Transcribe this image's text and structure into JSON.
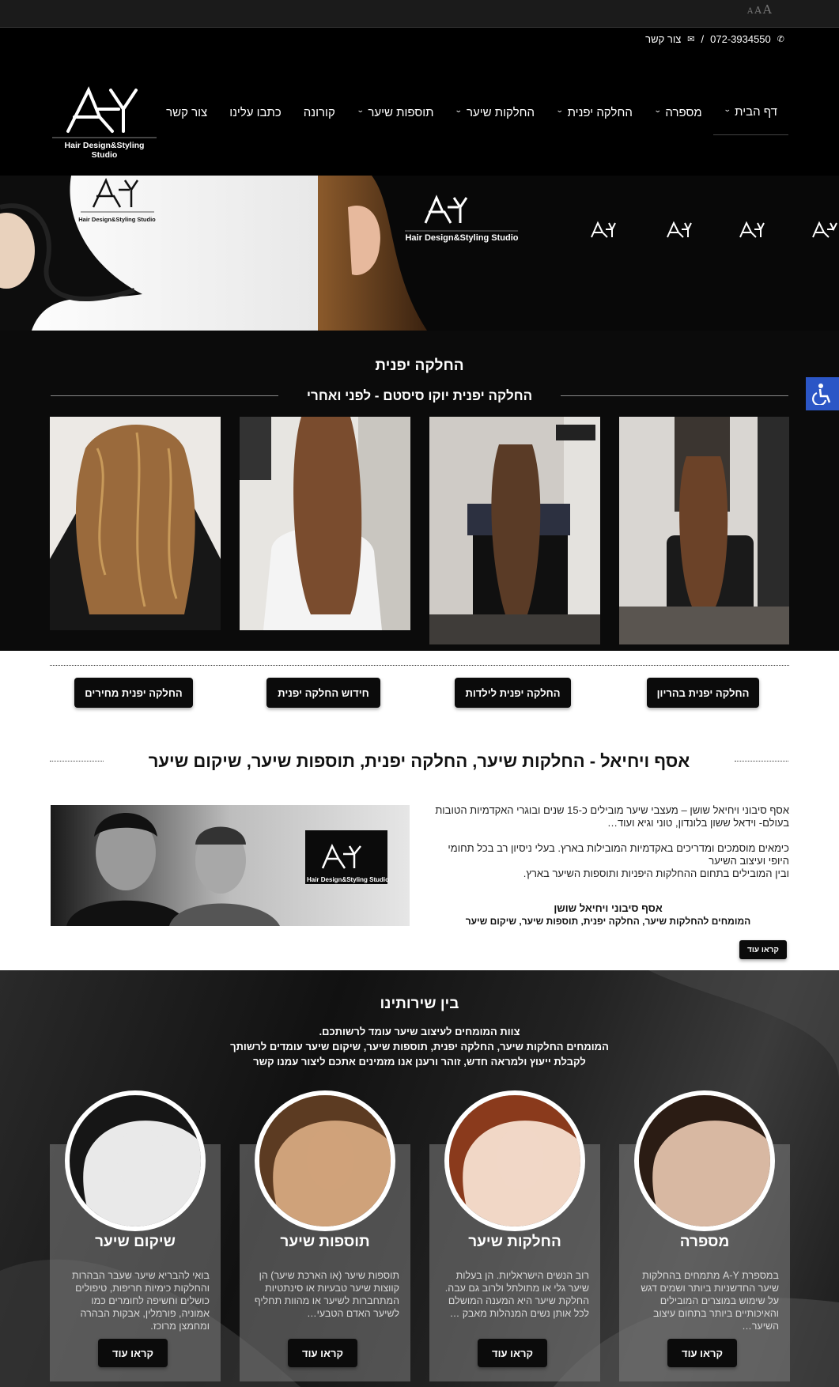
{
  "font_sizer": {
    "small": "A",
    "medium": "A",
    "large": "A"
  },
  "header": {
    "phone": "072-3934550",
    "separator": "/",
    "contact_link": "צור קשר",
    "logo_text": "Hair Design&Styling Studio",
    "logo_mark": "AY"
  },
  "nav": [
    {
      "label": "דף הבית",
      "dropdown": true,
      "active": true
    },
    {
      "label": "מספרה",
      "dropdown": true
    },
    {
      "label": "החלקה יפנית",
      "dropdown": true
    },
    {
      "label": "החלקות שיער",
      "dropdown": true
    },
    {
      "label": "תוספות שיער",
      "dropdown": true
    },
    {
      "label": "קורונה",
      "dropdown": false
    },
    {
      "label": "כתבו עלינו",
      "dropdown": false
    },
    {
      "label": "צור קשר",
      "dropdown": false
    }
  ],
  "banner": {
    "logo_text": "Hair Design&Styling Studio"
  },
  "gallery": {
    "title": "החלקה יפנית",
    "subtitle": "החלקה יפנית יוקו סיסטם - לפני ואחרי"
  },
  "japanese_buttons": [
    "החלקה יפנית בהריון",
    "החלקה יפנית לילדות",
    "חידוש החלקה יפנית",
    "החלקה יפנית מחירים"
  ],
  "about": {
    "heading": "אסף ויחיאל - החלקות שיער, החלקה יפנית, תוספות שיער, שיקום שיער",
    "p1": "אסף סיבוני ויחיאל שושן – מעצבי שיער מובילים כ-15 שנים ובוגרי האקדמיות הטובות בעולם- וידאל ששון בלונדון, טוני וגיא ועוד…",
    "p2": "כימאים מוסמכים ומדריכים באקדמיות המובילות בארץ. בעלי ניסיון רב בכל תחומי היופי ועיצוב השיער",
    "p3": "ובין המובילים בתחום ההחלקות היפניות ותוספות השיער בארץ.",
    "names": "אסף סיבוני ויחיאל שושן",
    "tagline": "המומחים להחלקות שיער, החלקה יפנית, תוספות שיער, שיקום שיער",
    "read_more": "קראו עוד",
    "photo_logo": "Hair Design&Styling Studio"
  },
  "services": {
    "title": "בין שירותינו",
    "intro1": "צוות המומחים לעיצוב שיער עומד לרשותכם.",
    "intro2": "המומחים החלקות שיער, החלקה יפנית, תוספות שיער, שיקום שיער עומדים לרשותך",
    "intro3": "לקבלת ייעוץ ולמראה חדש, זוהר ורענן אנו מזמינים אתכם ליצור עמנו קשר",
    "cards": [
      {
        "title": "מספרה",
        "text": "במספרת A-Y מתמחים בהחלקות שיער החדשניות ביותר ושמים דגש על שימוש במוצרים המובילים והאיכותיים ביותר בתחום עיצוב השיער…",
        "button": "קראו עוד"
      },
      {
        "title": "החלקות שיער",
        "text": "רוב הנשים הישראליות. הן בעלות שיער גלי או מתולתל ולרוב גם עבה. החלקת שיער היא המענה המושלם לכל אותן נשים המנהלות מאבק …",
        "button": "קראו עוד"
      },
      {
        "title": "תוספות שיער",
        "text": "תוספות שיער (או הארכת שיער) הן קווצות שיער טבעיות או סינתטיות המתחברות לשיער או מהוות תחליף לשיער האדם הטבעי…",
        "button": "קראו עוד"
      },
      {
        "title": "שיקום שיער",
        "text": "בואי להבריא שיער שעבר הבהרות והחלקות כימיות חריפות, טיפולים כושלים וחשיפה לחומרים כמו אמוניה, פורמלין, אבקות הבהרה ומחמצן מרוכז.",
        "button": "קראו עוד"
      }
    ]
  },
  "accessibility": {
    "icon": "wheelchair-icon"
  }
}
